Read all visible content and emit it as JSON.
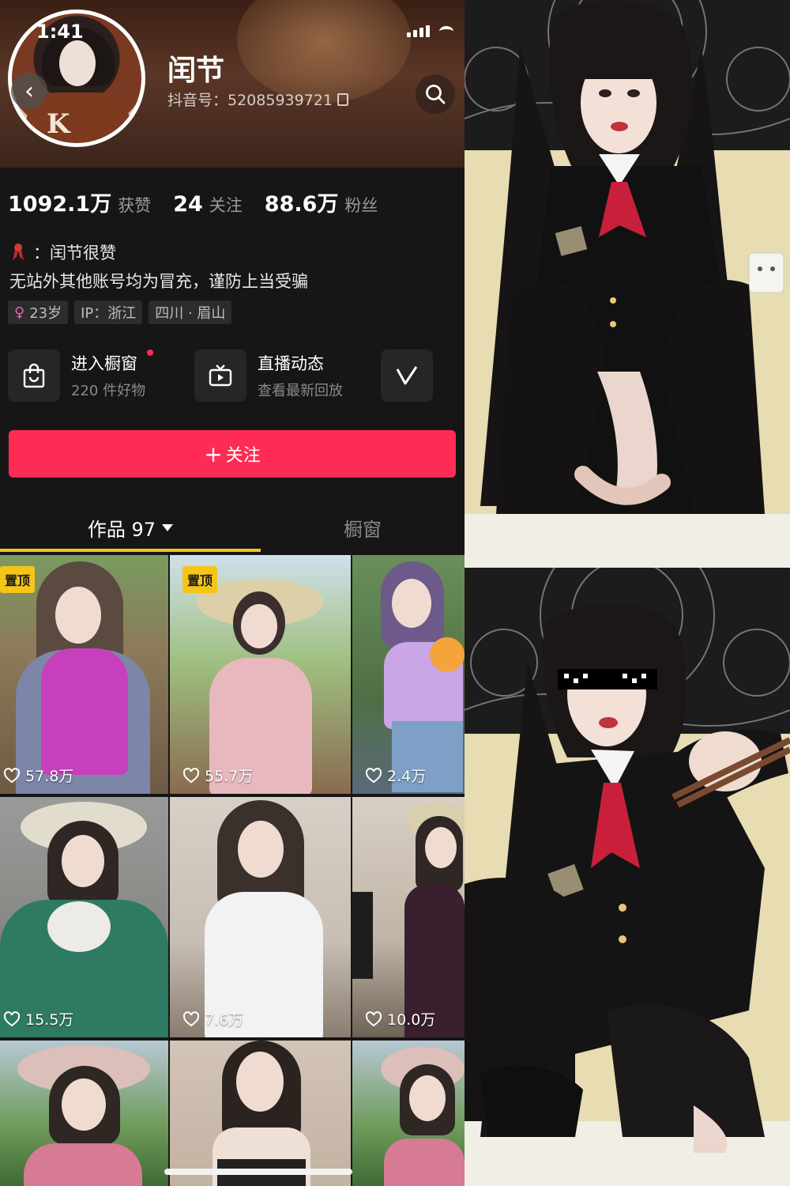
{
  "status_bar": {
    "time": "1:41"
  },
  "profile": {
    "name": "闰节",
    "douyin_id": "抖音号：52085939721",
    "stats": [
      {
        "value": "1092.1万",
        "label": "获赞"
      },
      {
        "value": "24",
        "label": "关注"
      },
      {
        "value": "88.6万",
        "label": "粉丝"
      }
    ],
    "bio_line1": "：闰节很赞",
    "bio_line2": "无站外其他账号均为冒充，谨防上当受骗",
    "tags": [
      {
        "text": "23岁",
        "female_icon": true
      },
      {
        "text": "IP：浙江"
      },
      {
        "text": "四川 · 眉山"
      }
    ]
  },
  "cards": [
    {
      "title": "进入橱窗",
      "sub": "220 件好物",
      "icon": "shopping-bag-icon",
      "dot": true
    },
    {
      "title": "直播动态",
      "sub": "查看最新回放",
      "icon": "tv-icon"
    }
  ],
  "follow_button": {
    "label": "关注",
    "color": "#fe2c55"
  },
  "tabs": {
    "works": "作品 97",
    "shop": "橱窗",
    "accent": "#f5c518"
  },
  "videos": [
    {
      "likes": "57.8万",
      "pinned": "置顶"
    },
    {
      "likes": "55.7万",
      "pinned": "置顶"
    },
    {
      "likes": "2.4万"
    },
    {
      "likes": "15.5万"
    },
    {
      "likes": "7.6万"
    },
    {
      "likes": "10.0万"
    },
    {
      "likes": ""
    },
    {
      "likes": ""
    },
    {
      "likes": ""
    }
  ]
}
